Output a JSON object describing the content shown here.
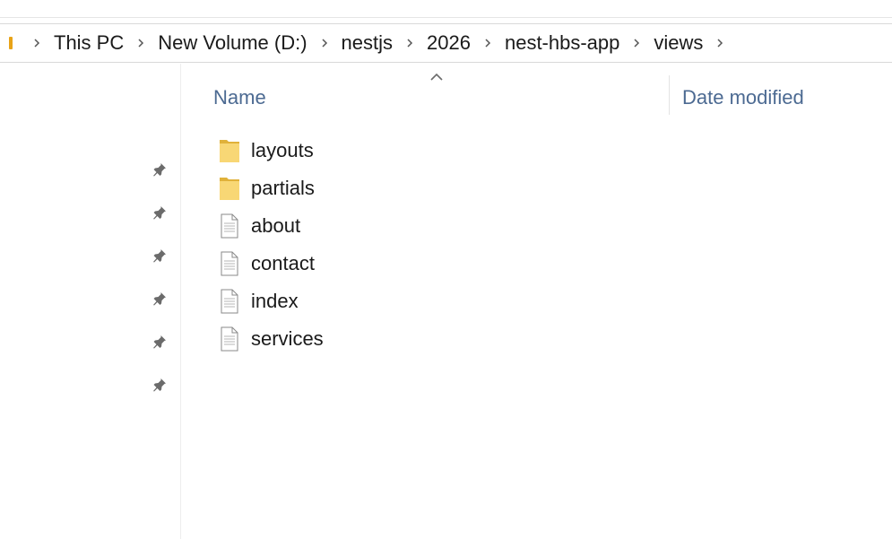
{
  "address_bar": {
    "crumbs": [
      "This PC",
      "New Volume (D:)",
      "nestjs",
      "2026",
      "nest-hbs-app",
      "views"
    ]
  },
  "columns": {
    "name": "Name",
    "date_modified": "Date modified"
  },
  "files": [
    {
      "name": "layouts",
      "type": "folder"
    },
    {
      "name": "partials",
      "type": "folder"
    },
    {
      "name": "about",
      "type": "file"
    },
    {
      "name": "contact",
      "type": "file"
    },
    {
      "name": "index",
      "type": "file"
    },
    {
      "name": "services",
      "type": "file"
    }
  ],
  "nav_pane": {
    "pin_count": 6,
    "pin_icon": "pin-icon"
  },
  "colors": {
    "folder": "#f2c94c",
    "header_text": "#4c6a92",
    "accent_stub": "#e8a317"
  }
}
